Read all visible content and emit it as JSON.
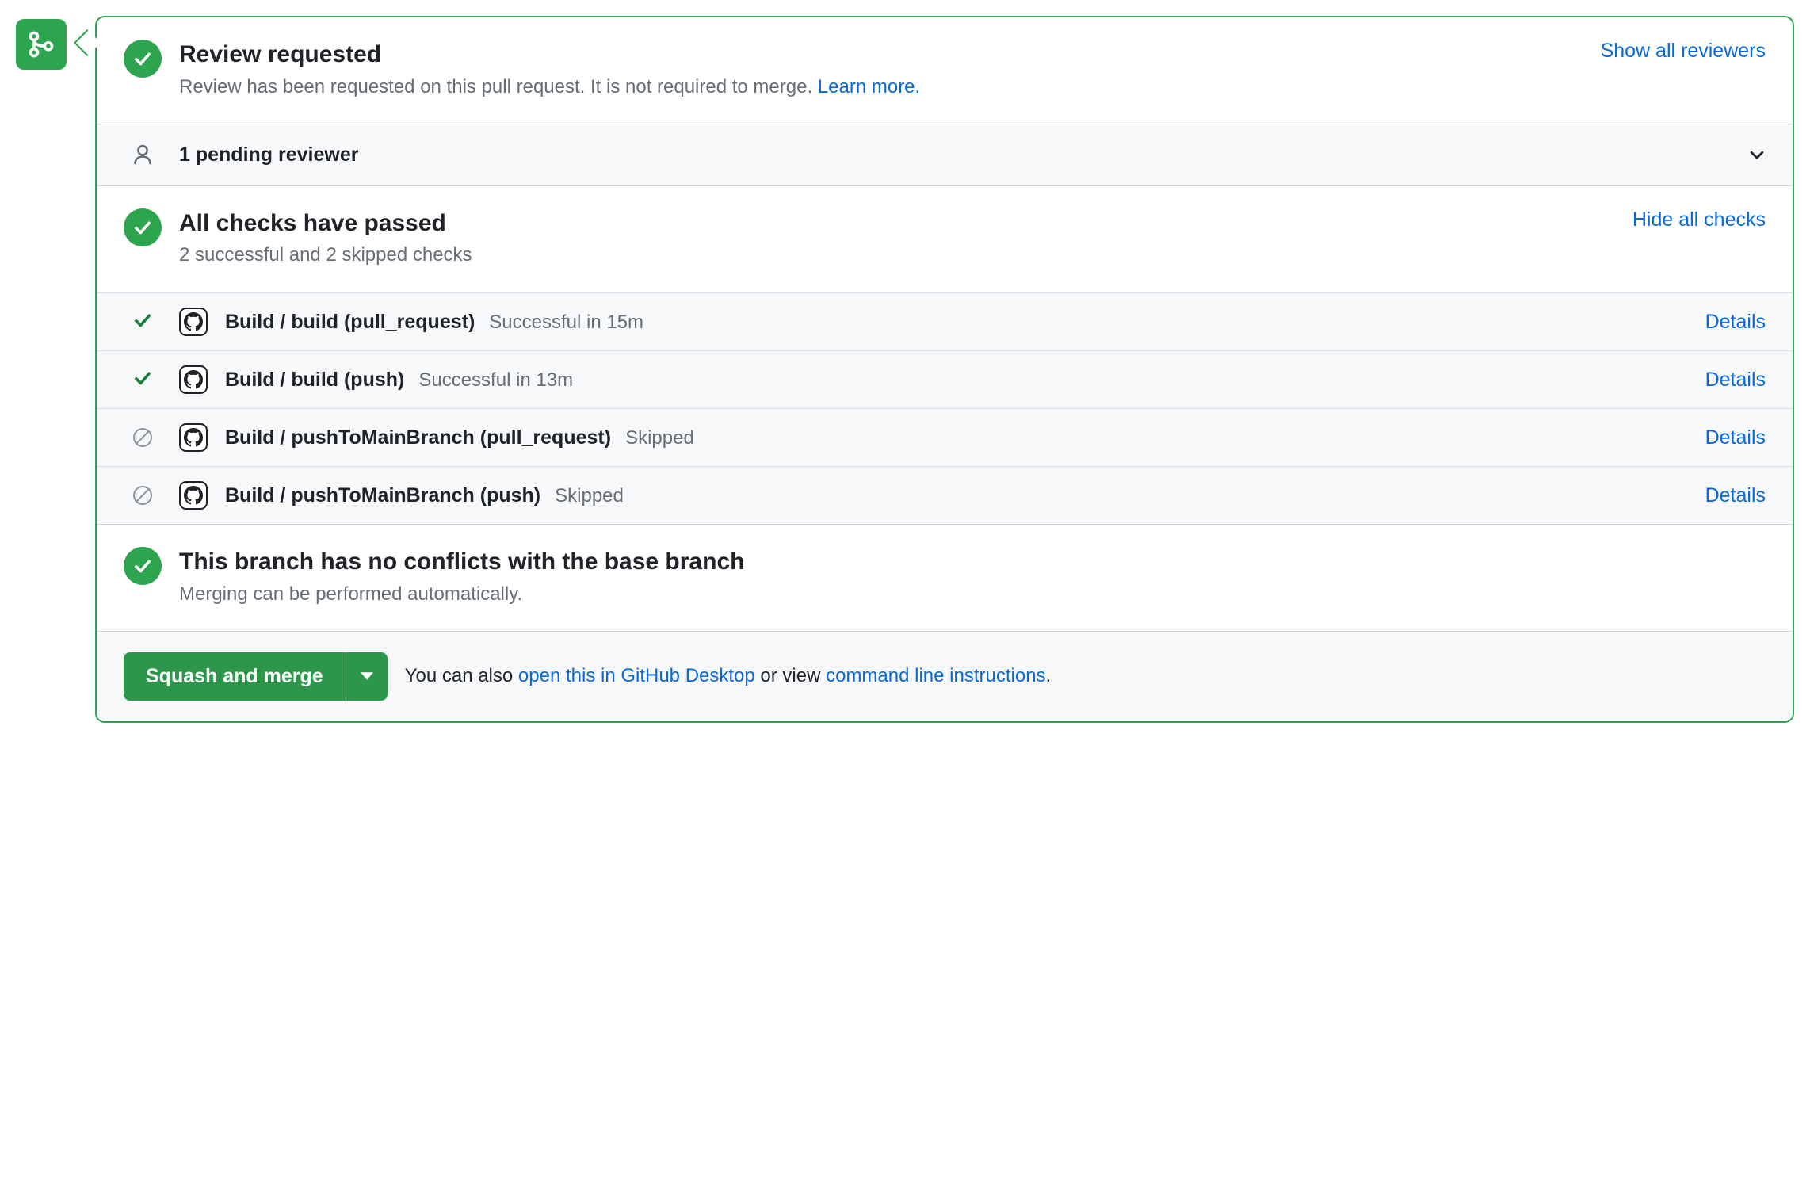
{
  "review": {
    "title": "Review requested",
    "subtitle_pre": "Review has been requested on this pull request. It is not required to merge. ",
    "learn_more": "Learn more.",
    "show_all": "Show all reviewers"
  },
  "pending": {
    "label": "1 pending reviewer"
  },
  "checks": {
    "title": "All checks have passed",
    "subtitle": "2 successful and 2 skipped checks",
    "hide_all": "Hide all checks",
    "details_label": "Details",
    "items": [
      {
        "status": "pass",
        "name": "Build / build (pull_request)",
        "result": "Successful in 15m"
      },
      {
        "status": "pass",
        "name": "Build / build (push)",
        "result": "Successful in 13m"
      },
      {
        "status": "skip",
        "name": "Build / pushToMainBranch (pull_request)",
        "result": "Skipped"
      },
      {
        "status": "skip",
        "name": "Build / pushToMainBranch (push)",
        "result": "Skipped"
      }
    ]
  },
  "conflicts": {
    "title": "This branch has no conflicts with the base branch",
    "subtitle": "Merging can be performed automatically."
  },
  "footer": {
    "button": "Squash and merge",
    "text_pre": "You can also ",
    "link_desktop": "open this in GitHub Desktop",
    "text_mid": " or view ",
    "link_cmd": "command line instructions",
    "text_post": "."
  }
}
